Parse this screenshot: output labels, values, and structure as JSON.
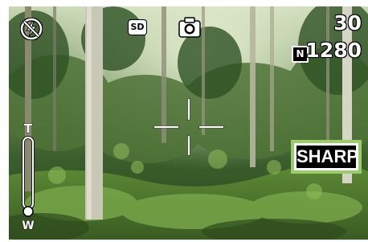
{
  "viewfinder": {
    "shots_remaining": "30",
    "resolution": "1280",
    "quality_badge": "N",
    "storage_badge": "SD",
    "sharpness_label": "SHARP",
    "zoom_top_label": "T",
    "zoom_bottom_label": "W",
    "zoom_level": 0,
    "icons": [
      "flash-off-icon",
      "camera-mode-icon",
      "focus-frame-icon"
    ],
    "colors": {
      "highlight": "#9ccc6a",
      "osd": "#ffffff"
    }
  }
}
